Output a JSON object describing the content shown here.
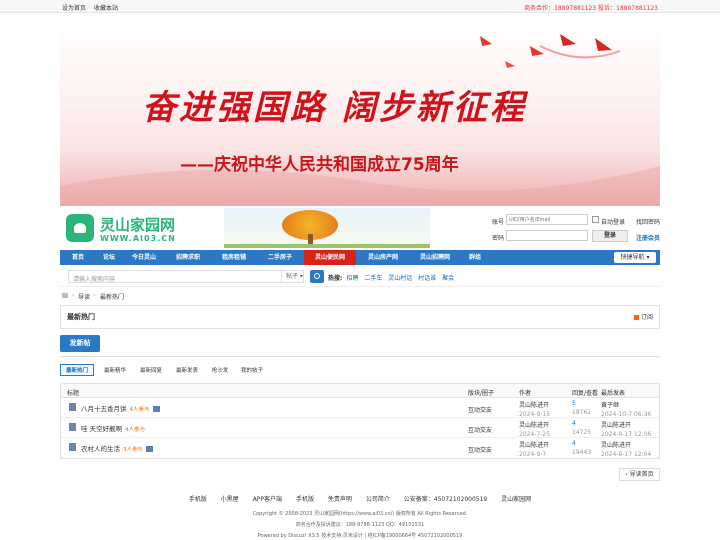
{
  "topbar": {
    "set_home": "设为首页",
    "bookmark": "收藏本站",
    "contact": "商务合作：18897881123 投诉：18897881123"
  },
  "banner": {
    "headline": "奋进强国路 阔步新征程",
    "subline": "——庆祝中华人民共和国成立75周年"
  },
  "logo": {
    "name": "灵山家园网",
    "url": "WWW.AI03.CN"
  },
  "login": {
    "account_label": "账号",
    "account_placeholder": "UID/用户名/Email",
    "auto_login": "自动登录",
    "forgot": "找回密码",
    "password_label": "密码",
    "login_button": "登录",
    "register": "注册会员"
  },
  "nav": {
    "items": [
      "首页",
      "论坛",
      "今日灵山",
      "招聘求职",
      "租房租铺",
      "二手房子",
      "灵山便民网",
      "灵山房产网",
      "灵山招聘网",
      "群组"
    ],
    "current": "灵山便民网",
    "quick_nav": "快捷导航 ▾"
  },
  "search": {
    "placeholder": "请输入搜索内容",
    "scope": "帖子 ▾",
    "hot_label": "热搜:",
    "hot_terms": [
      "招聘",
      "二手车",
      "灵山村话",
      "村话谁",
      "聚会"
    ]
  },
  "breadcrumb": {
    "sep": "›",
    "items": [
      "导读",
      "最新热门"
    ]
  },
  "section": {
    "title": "最新热门",
    "subscribe": "订阅"
  },
  "post_button": "发新帖",
  "tabs": [
    "最新热门",
    "最新精华",
    "最新回复",
    "最新发表",
    "抢沙发",
    "我的帖子"
  ],
  "table": {
    "headers": {
      "title": "标题",
      "forum": "版块/圈子",
      "author": "作者",
      "replies": "回复/查看",
      "last": "最后发表"
    },
    "rows": [
      {
        "title": "八月十五香月饼",
        "participants": "4人参与",
        "forum": "互动交友",
        "author": "灵山陈进开",
        "date": "2024-9-15",
        "replies": "5",
        "views": "18762",
        "last_user": "黄子继",
        "last_date": "2024-10-7 06:36"
      },
      {
        "title": "哇 天空好靓啊",
        "participants": "4人参与",
        "forum": "互动交友",
        "author": "灵山陈进开",
        "date": "2024-7-25",
        "replies": "4",
        "views": "14725",
        "last_user": "灵山陈进开",
        "last_date": "2024-9-17 12:06"
      },
      {
        "title": "农村人的生活",
        "participants": "3人参与",
        "forum": "互动交友",
        "author": "灵山陈进开",
        "date": "2024-9-7",
        "replies": "4",
        "views": "19443",
        "last_user": "灵山陈进开",
        "last_date": "2024-9-17 12:04"
      }
    ]
  },
  "back_button": "导读首页",
  "footer": {
    "links": [
      "手机版",
      "小黑屋",
      "APP客户端",
      "手机版",
      "免责声明",
      "公司简介",
      "公安备案：45072102000519",
      "灵山家园网"
    ],
    "copyright": "Copyright © 2008-2023 灵山家园网(https://www.ai03.cn/) 版权所有 All Rights Reserved.",
    "business": "商务合作及投诉建议：188-9788-1123 QQ：49101531",
    "powered": "Powered by Discuz! X3.5  技术支持:灵米设计  |  桂ICP备19000664号   45072102000519"
  },
  "colors": {
    "nav_blue": "#2b79c6",
    "nav_current": "#d9231a",
    "banner_red": "#d0131b",
    "logo_green": "#2bb57a"
  }
}
